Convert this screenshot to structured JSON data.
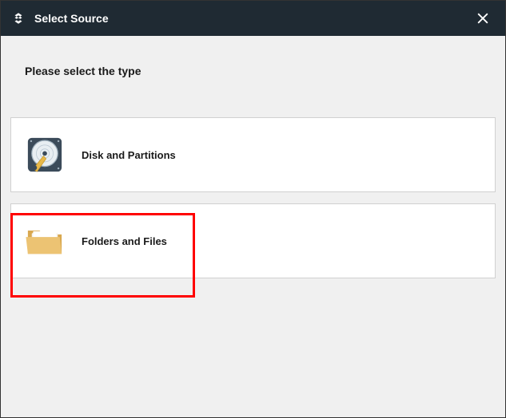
{
  "titlebar": {
    "title": "Select Source"
  },
  "instruction": "Please select the type",
  "options": [
    {
      "label": "Disk and Partitions"
    },
    {
      "label": "Folders and Files"
    }
  ]
}
